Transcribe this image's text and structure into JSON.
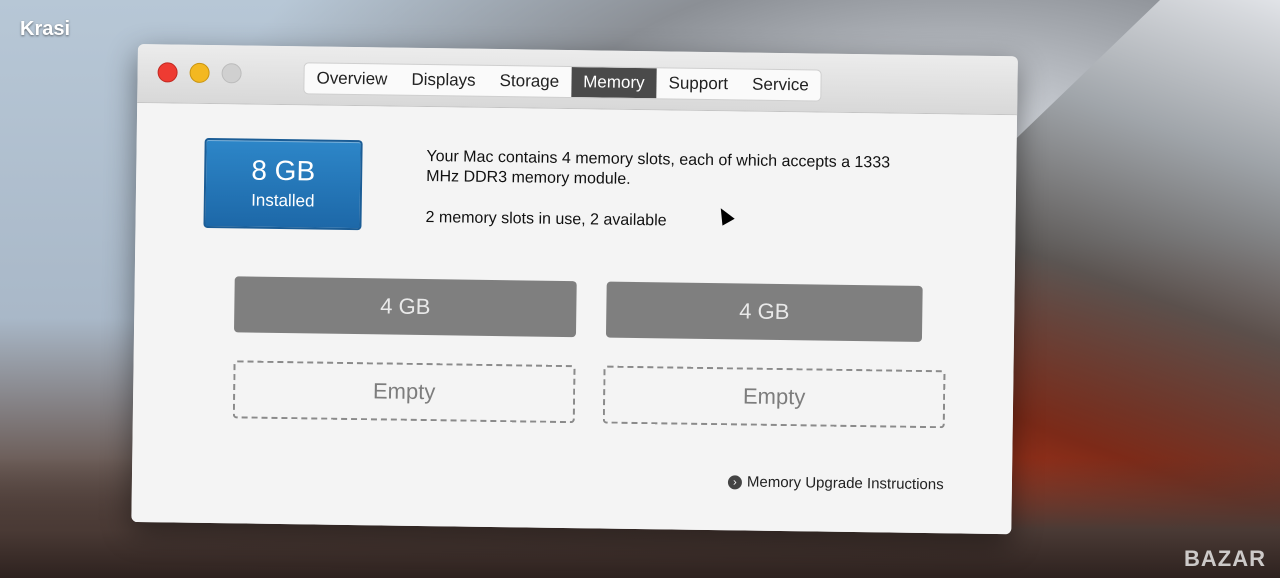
{
  "desktop": {
    "user_label": "Krasi",
    "watermark": "BAZAR"
  },
  "window": {
    "tabs": [
      "Overview",
      "Displays",
      "Storage",
      "Memory",
      "Support",
      "Service"
    ],
    "active_tab": "Memory"
  },
  "memory": {
    "total_size": "8 GB",
    "total_label": "Installed",
    "description": "Your Mac contains 4 memory slots, each of which accepts a 1333 MHz DDR3 memory module.",
    "slots_in_use": "2 memory slots in use, 2 available",
    "slots": [
      {
        "label": "4 GB",
        "state": "filled"
      },
      {
        "label": "4 GB",
        "state": "filled"
      },
      {
        "label": "Empty",
        "state": "empty"
      },
      {
        "label": "Empty",
        "state": "empty"
      }
    ],
    "upgrade_link": "Memory Upgrade Instructions"
  }
}
